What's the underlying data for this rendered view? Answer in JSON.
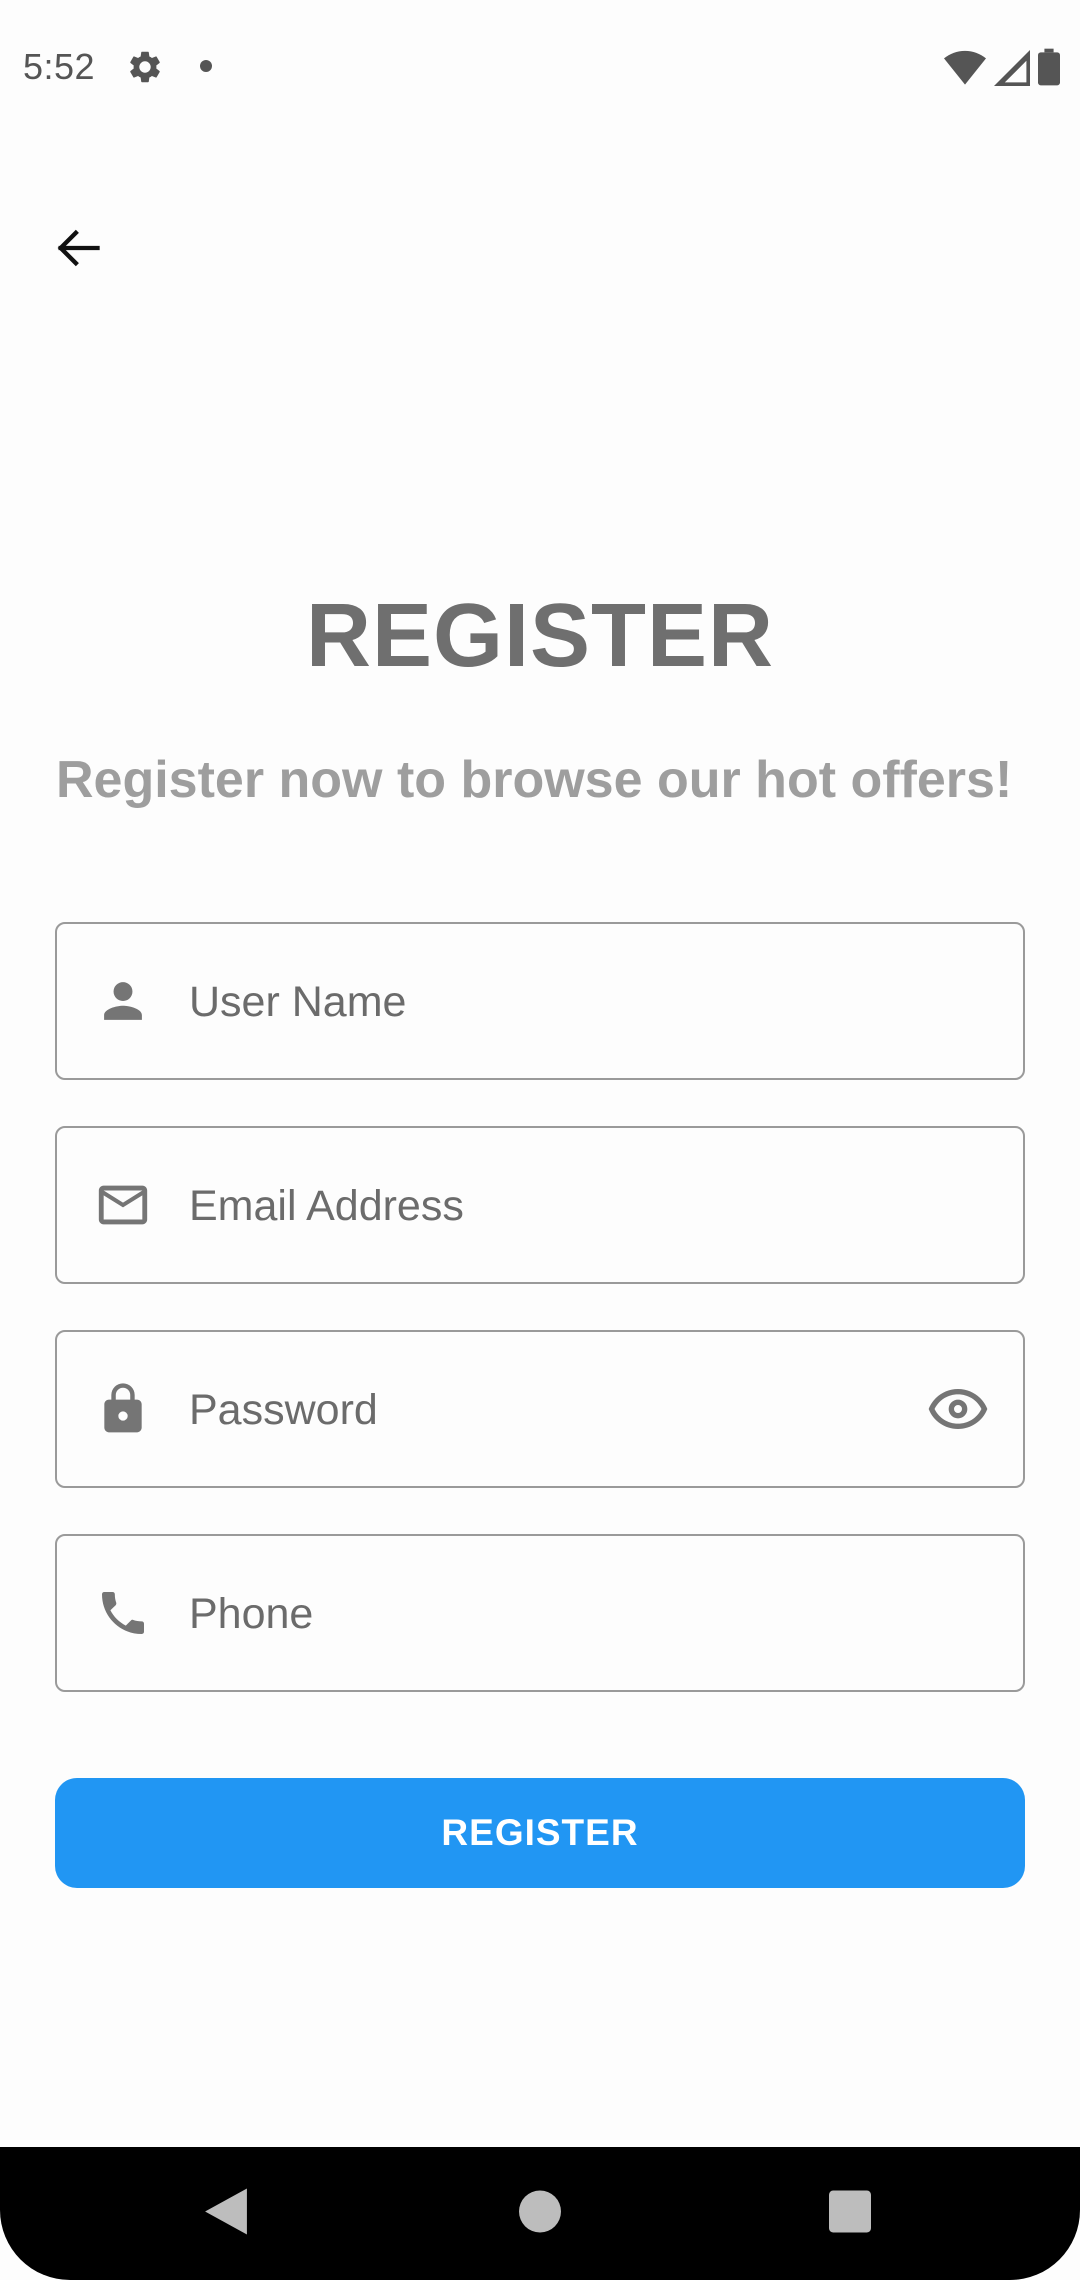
{
  "status_bar": {
    "time": "5:52",
    "icons": [
      "settings-gear-icon",
      "notification-dot-icon",
      "wifi-icon",
      "signal-icon",
      "battery-icon"
    ]
  },
  "nav": {
    "back_icon": "arrow-back-icon"
  },
  "header": {
    "title": "REGISTER",
    "subtitle": "Register now to browse our hot offers!"
  },
  "form": {
    "username": {
      "placeholder": "User Name",
      "value": "",
      "icon": "person-icon"
    },
    "email": {
      "placeholder": "Email Address",
      "value": "",
      "icon": "mail-icon"
    },
    "password": {
      "placeholder": "Password",
      "value": "",
      "icon": "lock-icon",
      "toggle_icon": "eye-icon"
    },
    "phone": {
      "placeholder": "Phone",
      "value": "",
      "icon": "phone-icon"
    },
    "submit_label": "REGISTER"
  },
  "system_nav": {
    "buttons": [
      "back-triangle-icon",
      "home-circle-icon",
      "recents-square-icon"
    ]
  },
  "colors": {
    "accent": "#2196f3",
    "title": "#6f6f6f",
    "subtitle": "#9e9e9e",
    "field_border": "#9a9a9a",
    "background": "#fdfdfd"
  }
}
